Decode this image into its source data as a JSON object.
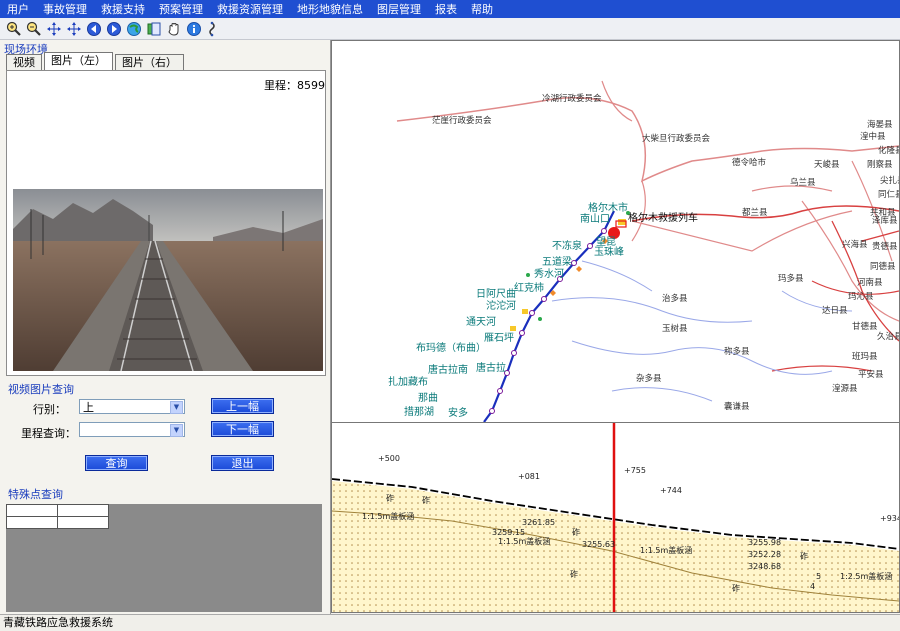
{
  "menu": [
    "用户",
    "事故管理",
    "救援支持",
    "预案管理",
    "救援资源管理",
    "地形地貌信息",
    "图层管理",
    "报表",
    "帮助"
  ],
  "toolbar_icons": [
    "zoom-in-icon",
    "zoom-out-icon",
    "pan-icon",
    "full-extent-icon",
    "back-icon",
    "forward-icon",
    "globe-icon",
    "layer-icon",
    "hand-icon",
    "info-icon",
    "measure-icon"
  ],
  "left": {
    "scene_title": "现场环境",
    "tabs": [
      "视频",
      "图片（左）",
      "图片（右）"
    ],
    "mileage_label": "里程：8599",
    "query_title": "视频图片查询",
    "direction_label": "行别：",
    "direction_value": "上",
    "mileage_query_label": "里程查询：",
    "mileage_query_value": "",
    "prev_button": "上一幅",
    "next_button": "下一幅",
    "query_button": "查询",
    "exit_button": "退出",
    "special_title": "特殊点查询"
  },
  "map": {
    "place_labels": [
      "冷湖行政委员会",
      "茫崖行政委员会",
      "大柴旦行政委员会",
      "德令哈市",
      "天峻县",
      "刚察县",
      "海晏县",
      "乌兰县",
      "都兰县",
      "共和县",
      "贵德县",
      "同德县",
      "兴海县",
      "玛多县",
      "称多县",
      "玉树县",
      "杂多县",
      "囊谦县",
      "治多县",
      "班玛县",
      "久治县",
      "甘德县",
      "达日县",
      "玛沁县",
      "泽库县",
      "河南县",
      "同仁县",
      "尖扎县",
      "化隆县",
      "湟中县",
      "平安县",
      "湟源县",
      "格尔木市",
      "南山口",
      "格尔木救援列车",
      "望昆",
      "不冻泉",
      "五道梁",
      "玉珠峰",
      "秀水河",
      "红克柿",
      "日阿尺曲",
      "沱沱河",
      "雁石坪",
      "通天河",
      "布玛德（布曲）",
      "安多",
      "唐古拉",
      "唐古拉南",
      "扎加藏布",
      "那曲",
      "措那湖"
    ]
  },
  "profile": {
    "elevation_labels": [
      "+500",
      "+081",
      "+755",
      "+744",
      "+934"
    ],
    "value_labels": [
      "3261.85",
      "3259.15",
      "3255.63",
      "3255.98",
      "3252.28",
      "3248.68"
    ],
    "terrain_labels": [
      "1:1.5m盖板涵",
      "1:1.5m盖板涵",
      "1:1.5m盖板涵",
      "1:2.5m盖板涵",
      "砟",
      "砟",
      "砟",
      "砟",
      "砟",
      "砟",
      "5",
      "4"
    ]
  },
  "status_text": "青藏铁路应急救援系统"
}
